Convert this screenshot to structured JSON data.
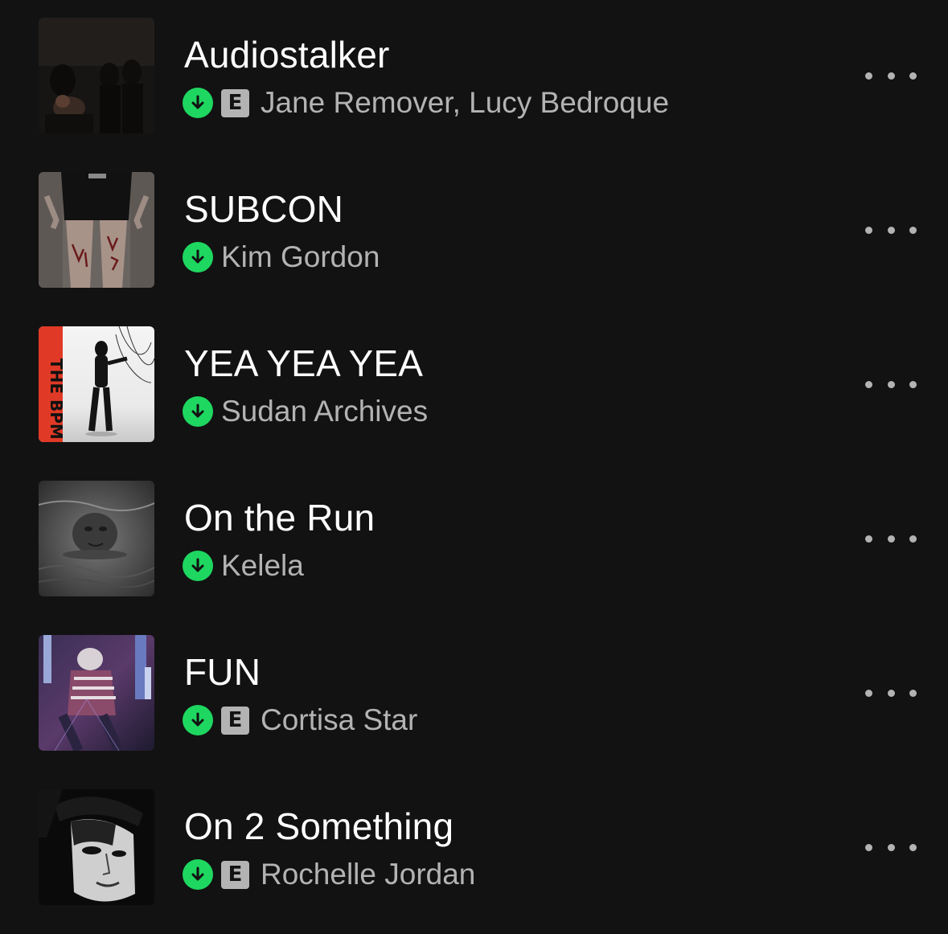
{
  "colors": {
    "background": "#121212",
    "title_text": "#ffffff",
    "secondary_text": "#b3b3b3",
    "download_badge": "#1ed760",
    "explicit_badge": "#b3b3b3"
  },
  "tracks": [
    {
      "title": "Audiostalker",
      "artists": "Jane Remover, Lucy Bedroque",
      "explicit": true,
      "explicit_label": "E",
      "downloaded": true,
      "download_icon": "arrow-down-icon",
      "more_icon": "more-options-icon"
    },
    {
      "title": "SUBCON",
      "artists": "Kim Gordon",
      "explicit": false,
      "downloaded": true,
      "download_icon": "arrow-down-icon",
      "more_icon": "more-options-icon"
    },
    {
      "title": "YEA YEA YEA",
      "artists": "Sudan Archives",
      "explicit": false,
      "downloaded": true,
      "download_icon": "arrow-down-icon",
      "more_icon": "more-options-icon",
      "cover_text": "THE BPM"
    },
    {
      "title": "On the Run",
      "artists": "Kelela",
      "explicit": false,
      "downloaded": true,
      "download_icon": "arrow-down-icon",
      "more_icon": "more-options-icon"
    },
    {
      "title": "FUN",
      "artists": "Cortisa Star",
      "explicit": true,
      "explicit_label": "E",
      "downloaded": true,
      "download_icon": "arrow-down-icon",
      "more_icon": "more-options-icon"
    },
    {
      "title": "On 2 Something",
      "artists": "Rochelle Jordan",
      "explicit": true,
      "explicit_label": "E",
      "downloaded": true,
      "download_icon": "arrow-down-icon",
      "more_icon": "more-options-icon"
    }
  ]
}
